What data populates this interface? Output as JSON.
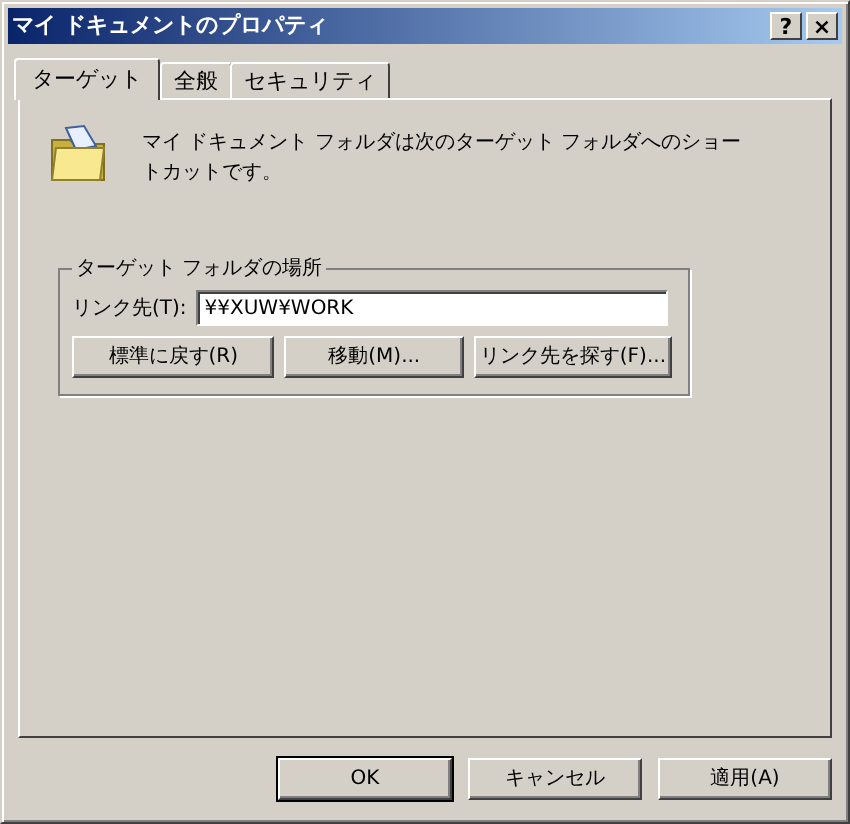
{
  "window": {
    "title": "マイ ドキュメントのプロパティ",
    "title_buttons": [
      "?",
      "×"
    ]
  },
  "tabs": [
    {
      "label": "ターゲット",
      "selected": true
    },
    {
      "label": "全般",
      "selected": false
    },
    {
      "label": "セキュリティ",
      "selected": false
    }
  ],
  "description": "マイ ドキュメント フォルダは次のターゲット フォルダへのショートカットです。",
  "group": {
    "title": "ターゲット フォルダの場所",
    "field_label": "リンク先(T):",
    "value": "¥¥XUW¥WORK",
    "buttons": [
      "標準に戻す(R)",
      "移動(M)...",
      "リンク先を探す(F)..."
    ]
  },
  "buttons": [
    {
      "label": "OK",
      "default": true
    },
    {
      "label": "キャンセル",
      "default": false
    },
    {
      "label": "適用(A)",
      "default": false
    }
  ]
}
